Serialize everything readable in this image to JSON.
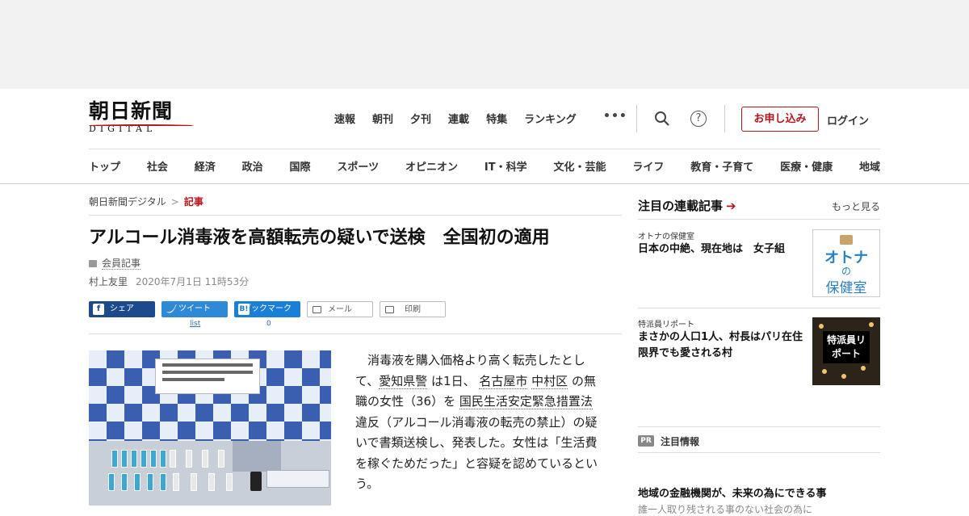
{
  "site": {
    "logo_main": "朝日新聞",
    "logo_sub": "DIGITAL",
    "brand_color": "#b8141c"
  },
  "topnav": [
    "速報",
    "朝刊",
    "夕刊",
    "連載",
    "特集",
    "ランキング"
  ],
  "header": {
    "more_icon": "•••",
    "subscribe": "お申し込み",
    "login": "ログイン",
    "help": "?"
  },
  "catnav": [
    "トップ",
    "社会",
    "経済",
    "政治",
    "国際",
    "スポーツ",
    "オピニオン",
    "IT・科学",
    "文化・芸能",
    "ライフ",
    "教育・子育て",
    "医療・健康",
    "地域"
  ],
  "breadcrumb": {
    "home": "朝日新聞デジタル",
    "sep": ">",
    "current": "記事"
  },
  "article": {
    "headline": "アルコール消毒液を高額転売の疑いで送検　全国初の適用",
    "members_label": "会員記事",
    "author": "村上友里",
    "date": "2020年7月1日 11時53分",
    "share": {
      "facebook": "シェア",
      "twitter": "ツイート",
      "hatena": "ブックマーク",
      "mail": "メール",
      "print": "印刷",
      "twitter_count": "list",
      "hatena_count": "0"
    },
    "body": {
      "p1": "消毒液を購入価格より高く転売したとして、",
      "l1": "愛知県警",
      "p2": " は1日、 ",
      "l2": "名古屋市",
      "p3": " ",
      "l3": "中村区",
      "p4": " の無職の女性（36）を ",
      "l4": "国民生活安定緊急措置法",
      "p5": " 違反（アルコール消毒液の転売の禁止）の疑いで書類送検し、発表した。女性は「生活費を稼ぐためだった」と容疑を認めているという。"
    }
  },
  "sidebar": {
    "title": "注目の連載記事",
    "more": "もっと見る",
    "items": [
      {
        "kicker": "オトナの保健室",
        "title": "日本の中絶、現在地は　女子組",
        "thumb_line1": "オトナ",
        "thumb_line2": "の",
        "thumb_line3": "保健室"
      },
      {
        "kicker": "特派員リポート",
        "title": "まさかの人口1人、村長はパリ在住　限界でも愛される村",
        "thumb_label": "特派員リポート"
      }
    ],
    "pr_tag": "PR",
    "pr_label": "注目情報",
    "pr_title": "地域の金融機関が、未来の為にできる事",
    "pr_sub": "誰一人取り残される事のない社会の為に"
  }
}
